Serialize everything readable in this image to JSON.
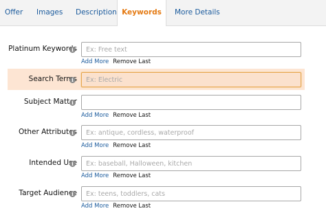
{
  "tabs": [
    {
      "label": "Offer"
    },
    {
      "label": "Images"
    },
    {
      "label": "Description"
    },
    {
      "label": "Keywords",
      "active": true
    },
    {
      "label": "More Details"
    }
  ],
  "info_icon": "info-icon",
  "fields": [
    {
      "label": "Platinum Keywords",
      "placeholder": "Ex: Free text",
      "add_more": "Add More",
      "remove_last": "Remove Last"
    },
    {
      "label": "Search Terms",
      "placeholder": "Ex: Electric"
    },
    {
      "label": "Subject Matter",
      "placeholder": "",
      "add_more": "Add More",
      "remove_last": "Remove Last"
    },
    {
      "label": "Other Attributes",
      "placeholder": "Ex: antique, cordless, waterproof",
      "add_more": "Add More",
      "remove_last": "Remove Last"
    },
    {
      "label": "Intended Use",
      "placeholder": "Ex: baseball, Halloween, kitchen",
      "add_more": "Add More",
      "remove_last": "Remove Last"
    },
    {
      "label": "Target Audience",
      "placeholder": "Ex: teens, toddlers, cats",
      "add_more": "Add More",
      "remove_last": "Remove Last"
    }
  ],
  "colors": {
    "link": "#1a5a9c",
    "active_tab": "#e47911",
    "highlight": "#fde5d3"
  }
}
